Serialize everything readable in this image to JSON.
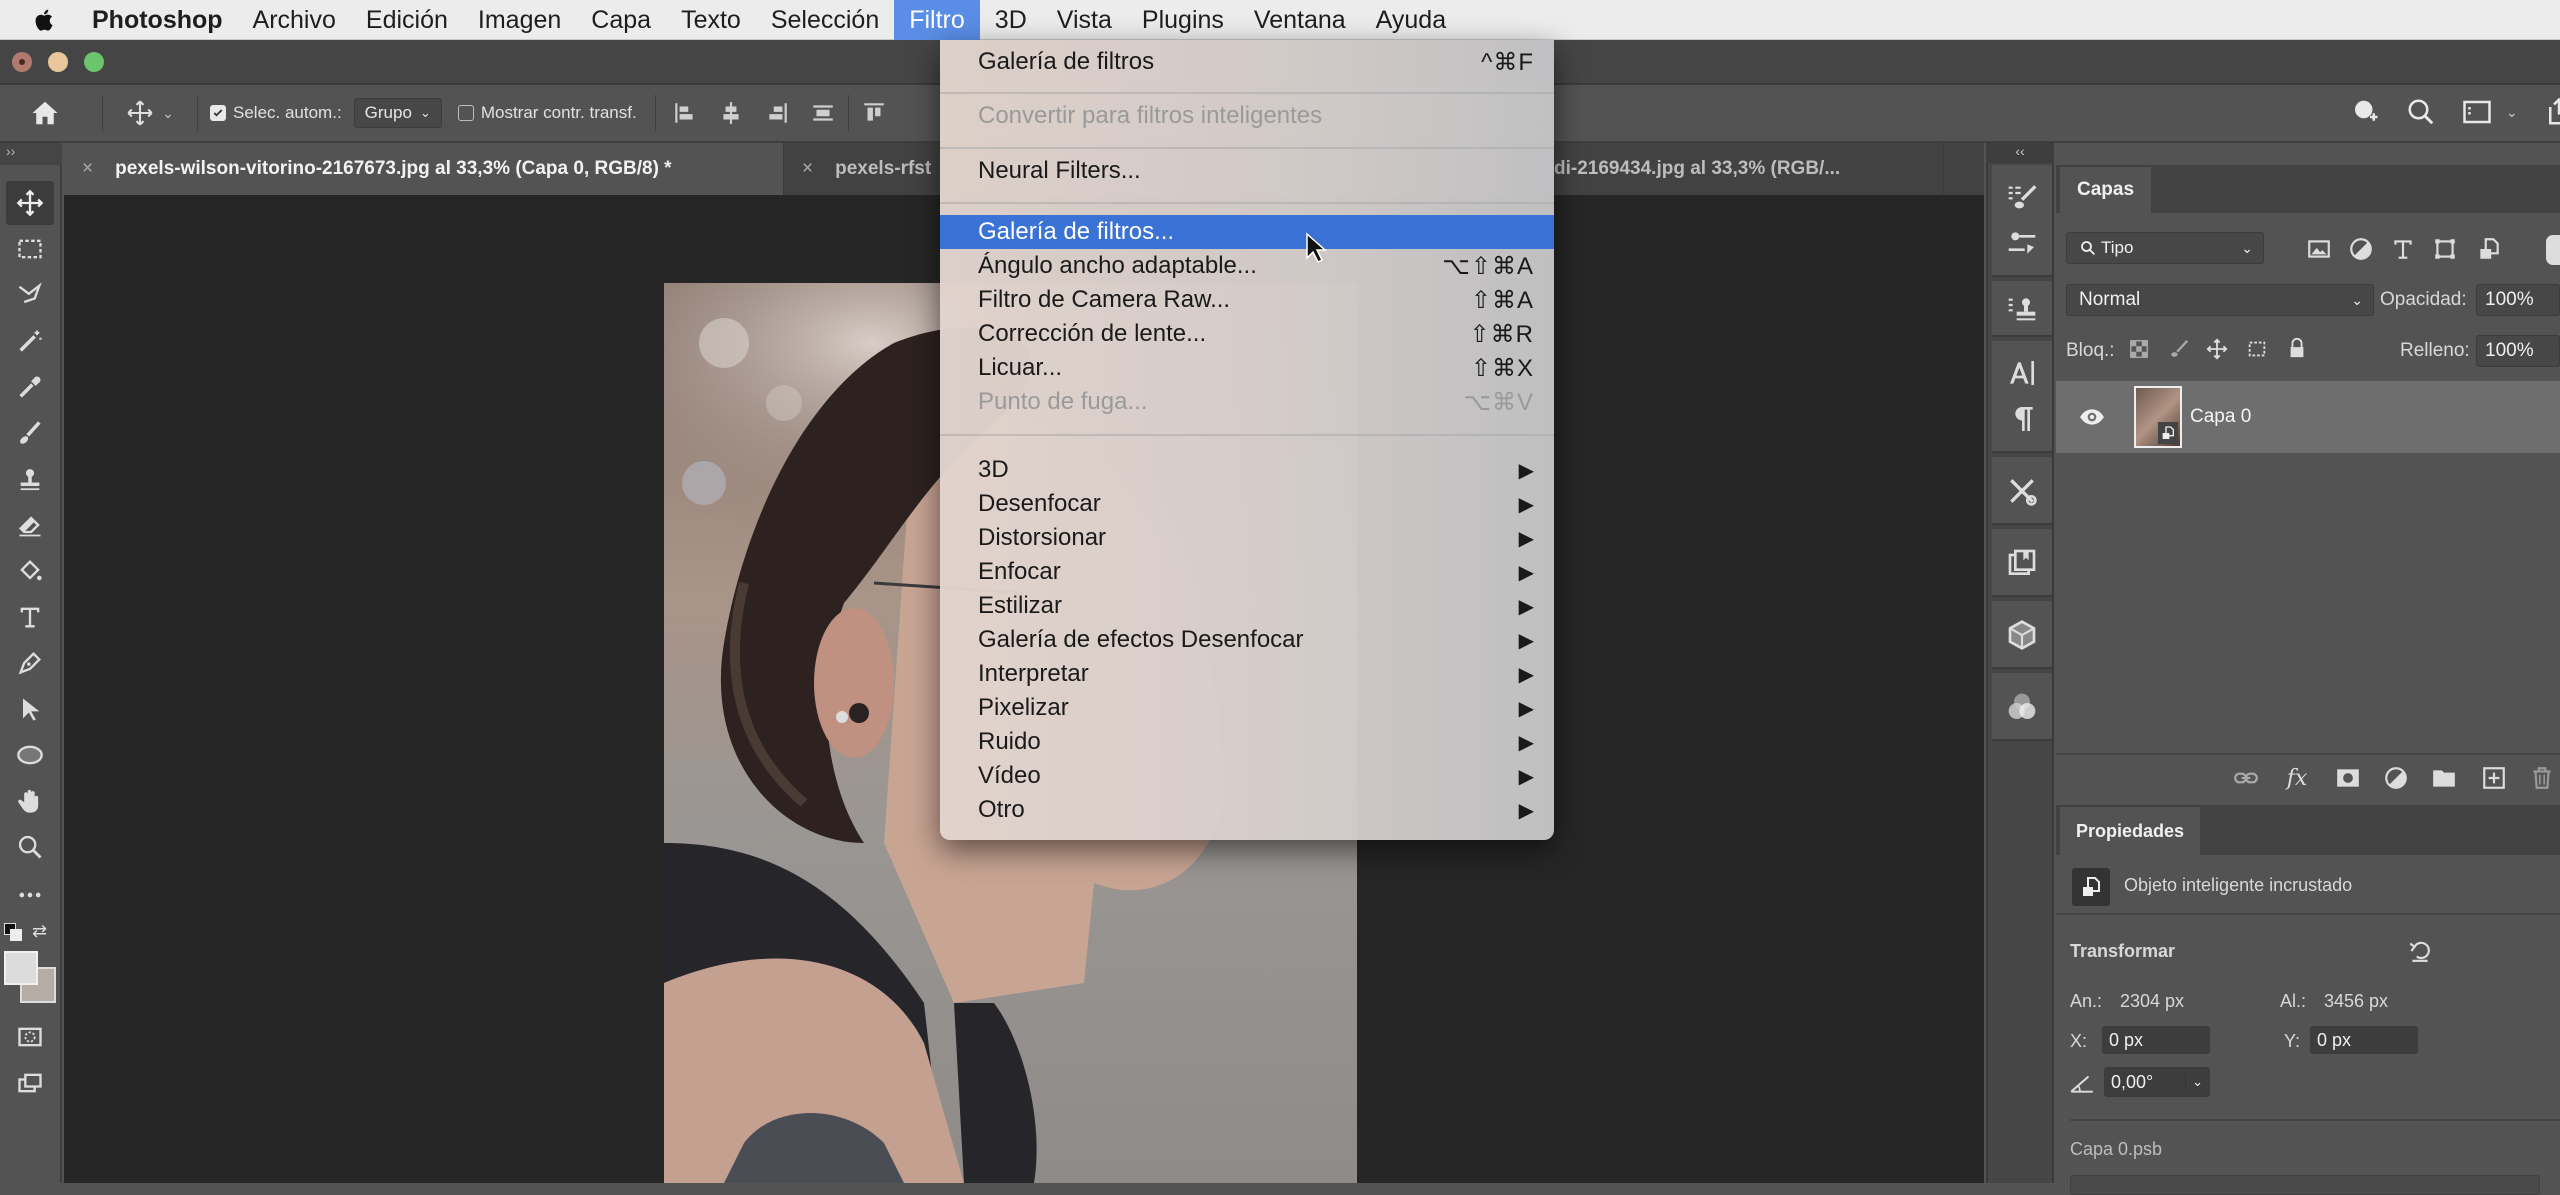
{
  "menubar": {
    "apple_icon": "apple-logo-icon",
    "items": [
      "Photoshop",
      "Archivo",
      "Edición",
      "Imagen",
      "Capa",
      "Texto",
      "Selección",
      "Filtro",
      "3D",
      "Vista",
      "Plugins",
      "Ventana",
      "Ayuda"
    ],
    "active_item": "Filtro"
  },
  "colors": {
    "menu_highlight": "#3b72d6",
    "menubar_active": "#5a8ee6",
    "traffic_close": "#b07a6e",
    "traffic_minimize": "#e8c79a",
    "traffic_zoom": "#6cc46c",
    "panel_bg": "#535353",
    "canvas_bg": "#262626"
  },
  "options_bar": {
    "home_icon": "home-icon",
    "move_tool_icon": "move-icon",
    "auto_select_label": "Selec. autom.:",
    "auto_select_checked": true,
    "auto_select_target": "Grupo",
    "show_transform_label": "Mostrar contr. transf.",
    "show_transform_checked": false,
    "align_icons": [
      "align-left-icon",
      "align-horizontal-center-icon",
      "align-right-icon",
      "distribute-vertical-icon",
      "align-top-icon"
    ],
    "right_icons": [
      "share-user-icon",
      "search-icon",
      "workspace-icon",
      "share-icon"
    ]
  },
  "tabs": [
    {
      "label": "pexels-wilson-vitorino-2167673.jpg al 33,3% (Capa 0, RGB/8) *",
      "active": true
    },
    {
      "label": "pexels-rfst",
      "active": false
    },
    {
      "label": "di-2169434.jpg al 33,3% (RGB/...",
      "active": false
    }
  ],
  "tools_collapse": "››",
  "tools": [
    "move",
    "marquee",
    "lasso",
    "magic-wand",
    "eyedropper",
    "brush",
    "clone-stamp",
    "eraser",
    "paint-bucket",
    "type",
    "pen",
    "path-selection",
    "ellipse",
    "hand",
    "zoom",
    "more",
    "swap-colors",
    "color-swatches",
    "quick-mask",
    "screen-mode"
  ],
  "filter_menu": {
    "items": [
      {
        "label": "Galería de filtros",
        "shortcut": "^⌘F",
        "disabled": false
      },
      {
        "sep": true
      },
      {
        "label": "Convertir para filtros inteligentes",
        "shortcut": "",
        "disabled": true
      },
      {
        "sep": true
      },
      {
        "label": "Neural Filters...",
        "shortcut": "",
        "disabled": false
      },
      {
        "sep": true
      },
      {
        "label": "Galería de filtros...",
        "shortcut": "",
        "disabled": false,
        "highlighted": true
      },
      {
        "label": "Ángulo ancho adaptable...",
        "shortcut": "⌥⇧⌘A",
        "disabled": false
      },
      {
        "label": "Filtro de Camera Raw...",
        "shortcut": "⇧⌘A",
        "disabled": false
      },
      {
        "label": "Corrección de lente...",
        "shortcut": "⇧⌘R",
        "disabled": false
      },
      {
        "label": "Licuar...",
        "shortcut": "⇧⌘X",
        "disabled": false
      },
      {
        "label": "Punto de fuga...",
        "shortcut": "⌥⌘V",
        "disabled": true
      },
      {
        "sep": true
      },
      {
        "label": "3D",
        "submenu": true
      },
      {
        "label": "Desenfocar",
        "submenu": true
      },
      {
        "label": "Distorsionar",
        "submenu": true
      },
      {
        "label": "Enfocar",
        "submenu": true
      },
      {
        "label": "Estilizar",
        "submenu": true
      },
      {
        "label": "Galería de efectos Desenfocar",
        "submenu": true
      },
      {
        "label": "Interpretar",
        "submenu": true
      },
      {
        "label": "Pixelizar",
        "submenu": true
      },
      {
        "label": "Ruido",
        "submenu": true
      },
      {
        "label": "Vídeo",
        "submenu": true
      },
      {
        "label": "Otro",
        "submenu": true
      }
    ],
    "submenu_arrow": "▶"
  },
  "right_strip": {
    "collapse": "‹‹",
    "icons": [
      "brush-presets-icon",
      "brush-settings-icon",
      "clone-source-icon",
      "character-icon",
      "paragraph-icon",
      "tool-presets-icon",
      "libraries-icon",
      "3d-icon",
      "channels-icon"
    ]
  },
  "layers_panel": {
    "tab": "Capas",
    "filter_label": "Tipo",
    "filter_icons": [
      "pixel-layer-filter-icon",
      "adjustment-layer-filter-icon",
      "type-layer-filter-icon",
      "shape-layer-filter-icon",
      "smart-object-filter-icon"
    ],
    "blend_mode": "Normal",
    "opacity_label": "Opacidad:",
    "opacity_value": "100%",
    "lock_label": "Bloq.:",
    "lock_icons": [
      "lock-transparency-icon",
      "lock-pixels-icon",
      "lock-position-icon",
      "lock-artboard-icon",
      "lock-all-icon"
    ],
    "fill_label": "Relleno:",
    "fill_value": "100%",
    "layers": [
      {
        "name": "Capa 0",
        "visible": true,
        "selected": true,
        "smart_object": true
      }
    ],
    "bottom_icons": [
      "link-layers-icon",
      "fx-icon",
      "add-mask-icon",
      "adjustment-layer-icon",
      "new-group-icon",
      "new-layer-icon",
      "delete-layer-icon"
    ]
  },
  "properties_panel": {
    "tab": "Propiedades",
    "type_label": "Objeto inteligente incrustado",
    "transform_heading": "Transformar",
    "width_label": "An.:",
    "width_value": "2304 px",
    "height_label": "Al.:",
    "height_value": "3456 px",
    "x_label": "X:",
    "x_value": "0 px",
    "y_label": "Y:",
    "y_value": "0 px",
    "angle_value": "0,00°",
    "file_name": "Capa 0.psb"
  }
}
